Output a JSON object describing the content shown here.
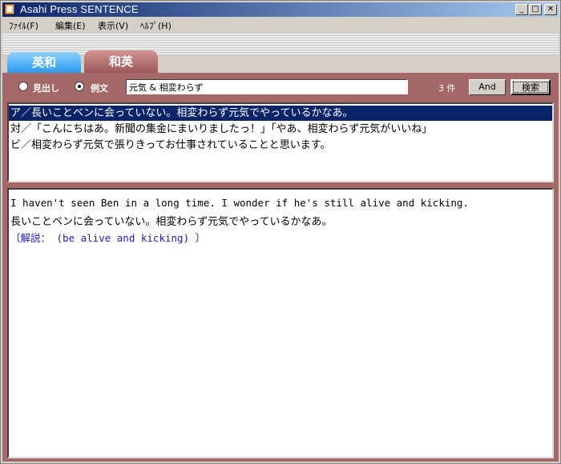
{
  "window": {
    "title": "Asahi Press SENTENCE",
    "controls": {
      "minimize": "_",
      "maximize": "□",
      "close": "✕"
    }
  },
  "menu": {
    "items": [
      "ﾌｧｲﾙ(F)",
      "編集(E)",
      "表示(V)",
      "ﾍﾙﾌﾟ(H)"
    ]
  },
  "tabs": [
    {
      "label": "英和",
      "active": false
    },
    {
      "label": "和英",
      "active": true
    }
  ],
  "search": {
    "mode_headword": "見出し",
    "mode_example": "例文",
    "selected_mode": "例文",
    "query": "元気 & 相変わらず",
    "result_count": "3 件",
    "and_button": "And",
    "search_button": "検索"
  },
  "results": [
    "ア／長いことベンに会っていない。相変わらず元気でやっているかなあ。",
    "対／「こんにちはあ。新聞の集金にまいりましたっ！」「やあ、相変わらず元気がいいね」",
    "ビ／相変わらず元気で張りきってお仕事されていることと思います。"
  ],
  "detail": {
    "english": "I haven't seen Ben in a long time. I wonder if he's still alive and kicking.",
    "japanese": "長いことベンに会っていない。相変わらず元気でやっているかなあ。",
    "note": "〔解説： (be alive and kicking) 〕"
  },
  "colors": {
    "title_gradient_start": "#0a246a",
    "title_gradient_end": "#a6caf0",
    "panel": "#a46868",
    "tab_eiwa": "#2a9af0",
    "tab_waei": "#9c5858",
    "selection": "#0a246a",
    "note_text": "#2020c0"
  }
}
